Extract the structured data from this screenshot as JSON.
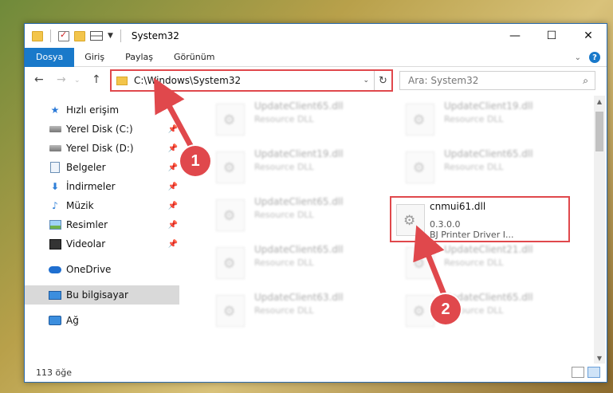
{
  "window": {
    "title": "System32",
    "controls": {
      "minimize": "—",
      "maximize": "☐",
      "close": "✕"
    }
  },
  "ribbon": {
    "tabs": [
      {
        "label": "Dosya",
        "active": true
      },
      {
        "label": "Giriş"
      },
      {
        "label": "Paylaş"
      },
      {
        "label": "Görünüm"
      }
    ],
    "help": "?"
  },
  "address": {
    "path": "C:\\Windows\\System32"
  },
  "search": {
    "placeholder": "Ara: System32"
  },
  "sidebar": {
    "items": [
      {
        "label": "Hızlı erişim",
        "icon": "star-icon"
      },
      {
        "label": "Yerel Disk (C:)",
        "icon": "drive-icon",
        "pinned": true
      },
      {
        "label": "Yerel Disk (D:)",
        "icon": "drive-icon",
        "pinned": true
      },
      {
        "label": "Belgeler",
        "icon": "document-icon",
        "pinned": true
      },
      {
        "label": "İndirmeler",
        "icon": "download-icon",
        "pinned": true
      },
      {
        "label": "Müzik",
        "icon": "music-icon",
        "pinned": true
      },
      {
        "label": "Resimler",
        "icon": "pictures-icon",
        "pinned": true
      },
      {
        "label": "Videolar",
        "icon": "videos-icon",
        "pinned": true
      },
      {
        "label": "OneDrive",
        "icon": "cloud-icon"
      },
      {
        "label": "Bu bilgisayar",
        "icon": "computer-icon",
        "selected": true
      },
      {
        "label": "Ağ",
        "icon": "network-icon"
      }
    ]
  },
  "files": [
    {
      "name": "UpdateClient65.dll",
      "type": "Resource DLL"
    },
    {
      "name": "UpdateClient19.dll",
      "type": "Resource DLL"
    },
    {
      "name": "UpdateClient19.dll",
      "type": "Resource DLL"
    },
    {
      "name": "UpdateClient65.dll",
      "type": "Resource DLL"
    },
    {
      "name": "UpdateClient65.dll",
      "type": "Resource DLL"
    },
    {
      "name": "UpdateClient65.dll",
      "type": "Resource DLL"
    },
    {
      "name": "UpdateClient21.dll",
      "type": "Resource DLL"
    },
    {
      "name": "UpdateClient63.dll",
      "type": "Resource DLL"
    },
    {
      "name": "UpdateClient65.dll",
      "type": "Resource DLL"
    }
  ],
  "highlighted_file": {
    "name": "cnmui61.dll",
    "version": "0.3.0.0",
    "description": "BJ Printer Driver I..."
  },
  "status": {
    "count": "113 öğe"
  },
  "callouts": {
    "one": "1",
    "two": "2"
  },
  "colors": {
    "accent": "#1979ca",
    "highlight": "#e0484c"
  }
}
